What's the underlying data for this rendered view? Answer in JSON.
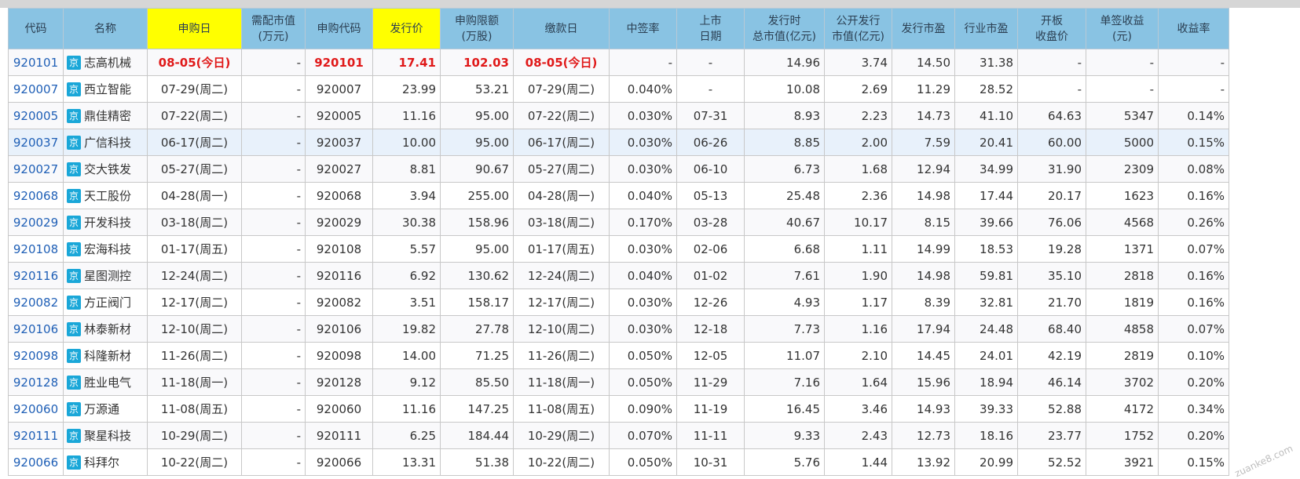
{
  "headers": [
    {
      "key": "code",
      "label": "代码"
    },
    {
      "key": "name",
      "label": "名称"
    },
    {
      "key": "sub_date",
      "label": "申购日",
      "highlight": true
    },
    {
      "key": "need_mv",
      "label": "需配市值\n(万元)"
    },
    {
      "key": "sub_code",
      "label": "申购代码"
    },
    {
      "key": "price",
      "label": "发行价",
      "highlight": true
    },
    {
      "key": "limit",
      "label": "申购限额\n(万股)"
    },
    {
      "key": "pay_date",
      "label": "缴款日"
    },
    {
      "key": "win_rate",
      "label": "中签率"
    },
    {
      "key": "list_date",
      "label": "上市\n日期"
    },
    {
      "key": "total_mv",
      "label": "发行时\n总市值(亿元)"
    },
    {
      "key": "public_mv",
      "label": "公开发行\n市值(亿元)"
    },
    {
      "key": "pe",
      "label": "发行市盈"
    },
    {
      "key": "ind_pe",
      "label": "行业市盈"
    },
    {
      "key": "open_price",
      "label": "开板\n收盘价"
    },
    {
      "key": "profit",
      "label": "单签收益\n(元)"
    },
    {
      "key": "yield",
      "label": "收益率"
    }
  ],
  "badge": "京",
  "rows": [
    {
      "code": "920101",
      "name": "志高机械",
      "sub_date": "08-05(今日)",
      "need_mv": "-",
      "sub_code": "920101",
      "price": "17.41",
      "limit": "102.03",
      "pay_date": "08-05(今日)",
      "win_rate": "-",
      "list_date": "-",
      "total_mv": "14.96",
      "public_mv": "3.74",
      "pe": "14.50",
      "ind_pe": "31.38",
      "open_price": "-",
      "profit": "-",
      "yield": "-",
      "today": true
    },
    {
      "code": "920007",
      "name": "西立智能",
      "sub_date": "07-29(周二)",
      "need_mv": "-",
      "sub_code": "920007",
      "price": "23.99",
      "limit": "53.21",
      "pay_date": "07-29(周二)",
      "win_rate": "0.040%",
      "list_date": "-",
      "total_mv": "10.08",
      "public_mv": "2.69",
      "pe": "11.29",
      "ind_pe": "28.52",
      "open_price": "-",
      "profit": "-",
      "yield": "-"
    },
    {
      "code": "920005",
      "name": "鼎佳精密",
      "sub_date": "07-22(周二)",
      "need_mv": "-",
      "sub_code": "920005",
      "price": "11.16",
      "limit": "95.00",
      "pay_date": "07-22(周二)",
      "win_rate": "0.030%",
      "list_date": "07-31",
      "total_mv": "8.93",
      "public_mv": "2.23",
      "pe": "14.73",
      "ind_pe": "41.10",
      "open_price": "64.63",
      "profit": "5347",
      "yield": "0.14%"
    },
    {
      "code": "920037",
      "name": "广信科技",
      "sub_date": "06-17(周二)",
      "need_mv": "-",
      "sub_code": "920037",
      "price": "10.00",
      "limit": "95.00",
      "pay_date": "06-17(周二)",
      "win_rate": "0.030%",
      "list_date": "06-26",
      "total_mv": "8.85",
      "public_mv": "2.00",
      "pe": "7.59",
      "ind_pe": "20.41",
      "open_price": "60.00",
      "profit": "5000",
      "yield": "0.15%",
      "hover": true
    },
    {
      "code": "920027",
      "name": "交大铁发",
      "sub_date": "05-27(周二)",
      "need_mv": "-",
      "sub_code": "920027",
      "price": "8.81",
      "limit": "90.67",
      "pay_date": "05-27(周二)",
      "win_rate": "0.030%",
      "list_date": "06-10",
      "total_mv": "6.73",
      "public_mv": "1.68",
      "pe": "12.94",
      "ind_pe": "34.99",
      "open_price": "31.90",
      "profit": "2309",
      "yield": "0.08%"
    },
    {
      "code": "920068",
      "name": "天工股份",
      "sub_date": "04-28(周一)",
      "need_mv": "-",
      "sub_code": "920068",
      "price": "3.94",
      "limit": "255.00",
      "pay_date": "04-28(周一)",
      "win_rate": "0.040%",
      "list_date": "05-13",
      "total_mv": "25.48",
      "public_mv": "2.36",
      "pe": "14.98",
      "ind_pe": "17.44",
      "open_price": "20.17",
      "profit": "1623",
      "yield": "0.16%"
    },
    {
      "code": "920029",
      "name": "开发科技",
      "sub_date": "03-18(周二)",
      "need_mv": "-",
      "sub_code": "920029",
      "price": "30.38",
      "limit": "158.96",
      "pay_date": "03-18(周二)",
      "win_rate": "0.170%",
      "list_date": "03-28",
      "total_mv": "40.67",
      "public_mv": "10.17",
      "pe": "8.15",
      "ind_pe": "39.66",
      "open_price": "76.06",
      "profit": "4568",
      "yield": "0.26%"
    },
    {
      "code": "920108",
      "name": "宏海科技",
      "sub_date": "01-17(周五)",
      "need_mv": "-",
      "sub_code": "920108",
      "price": "5.57",
      "limit": "95.00",
      "pay_date": "01-17(周五)",
      "win_rate": "0.030%",
      "list_date": "02-06",
      "total_mv": "6.68",
      "public_mv": "1.11",
      "pe": "14.99",
      "ind_pe": "18.53",
      "open_price": "19.28",
      "profit": "1371",
      "yield": "0.07%"
    },
    {
      "code": "920116",
      "name": "星图测控",
      "sub_date": "12-24(周二)",
      "need_mv": "-",
      "sub_code": "920116",
      "price": "6.92",
      "limit": "130.62",
      "pay_date": "12-24(周二)",
      "win_rate": "0.040%",
      "list_date": "01-02",
      "total_mv": "7.61",
      "public_mv": "1.90",
      "pe": "14.98",
      "ind_pe": "59.81",
      "open_price": "35.10",
      "profit": "2818",
      "yield": "0.16%"
    },
    {
      "code": "920082",
      "name": "方正阀门",
      "sub_date": "12-17(周二)",
      "need_mv": "-",
      "sub_code": "920082",
      "price": "3.51",
      "limit": "158.17",
      "pay_date": "12-17(周二)",
      "win_rate": "0.030%",
      "list_date": "12-26",
      "total_mv": "4.93",
      "public_mv": "1.17",
      "pe": "8.39",
      "ind_pe": "32.81",
      "open_price": "21.70",
      "profit": "1819",
      "yield": "0.16%"
    },
    {
      "code": "920106",
      "name": "林泰新材",
      "sub_date": "12-10(周二)",
      "need_mv": "-",
      "sub_code": "920106",
      "price": "19.82",
      "limit": "27.78",
      "pay_date": "12-10(周二)",
      "win_rate": "0.030%",
      "list_date": "12-18",
      "total_mv": "7.73",
      "public_mv": "1.16",
      "pe": "17.94",
      "ind_pe": "24.48",
      "open_price": "68.40",
      "profit": "4858",
      "yield": "0.07%"
    },
    {
      "code": "920098",
      "name": "科隆新材",
      "sub_date": "11-26(周二)",
      "need_mv": "-",
      "sub_code": "920098",
      "price": "14.00",
      "limit": "71.25",
      "pay_date": "11-26(周二)",
      "win_rate": "0.050%",
      "list_date": "12-05",
      "total_mv": "11.07",
      "public_mv": "2.10",
      "pe": "14.45",
      "ind_pe": "24.01",
      "open_price": "42.19",
      "profit": "2819",
      "yield": "0.10%"
    },
    {
      "code": "920128",
      "name": "胜业电气",
      "sub_date": "11-18(周一)",
      "need_mv": "-",
      "sub_code": "920128",
      "price": "9.12",
      "limit": "85.50",
      "pay_date": "11-18(周一)",
      "win_rate": "0.050%",
      "list_date": "11-29",
      "total_mv": "7.16",
      "public_mv": "1.64",
      "pe": "15.96",
      "ind_pe": "18.94",
      "open_price": "46.14",
      "profit": "3702",
      "yield": "0.20%"
    },
    {
      "code": "920060",
      "name": "万源通",
      "sub_date": "11-08(周五)",
      "need_mv": "-",
      "sub_code": "920060",
      "price": "11.16",
      "limit": "147.25",
      "pay_date": "11-08(周五)",
      "win_rate": "0.090%",
      "list_date": "11-19",
      "total_mv": "16.45",
      "public_mv": "3.46",
      "pe": "14.93",
      "ind_pe": "39.33",
      "open_price": "52.88",
      "profit": "4172",
      "yield": "0.34%"
    },
    {
      "code": "920111",
      "name": "聚星科技",
      "sub_date": "10-29(周二)",
      "need_mv": "-",
      "sub_code": "920111",
      "price": "6.25",
      "limit": "184.44",
      "pay_date": "10-29(周二)",
      "win_rate": "0.070%",
      "list_date": "11-11",
      "total_mv": "9.33",
      "public_mv": "2.43",
      "pe": "12.73",
      "ind_pe": "18.16",
      "open_price": "23.77",
      "profit": "1752",
      "yield": "0.20%"
    },
    {
      "code": "920066",
      "name": "科拜尔",
      "sub_date": "10-22(周二)",
      "need_mv": "-",
      "sub_code": "920066",
      "price": "13.31",
      "limit": "51.38",
      "pay_date": "10-22(周二)",
      "win_rate": "0.050%",
      "list_date": "10-31",
      "total_mv": "5.76",
      "public_mv": "1.44",
      "pe": "13.92",
      "ind_pe": "20.99",
      "open_price": "52.52",
      "profit": "3921",
      "yield": "0.15%"
    }
  ],
  "watermark": "zuanke8.com"
}
